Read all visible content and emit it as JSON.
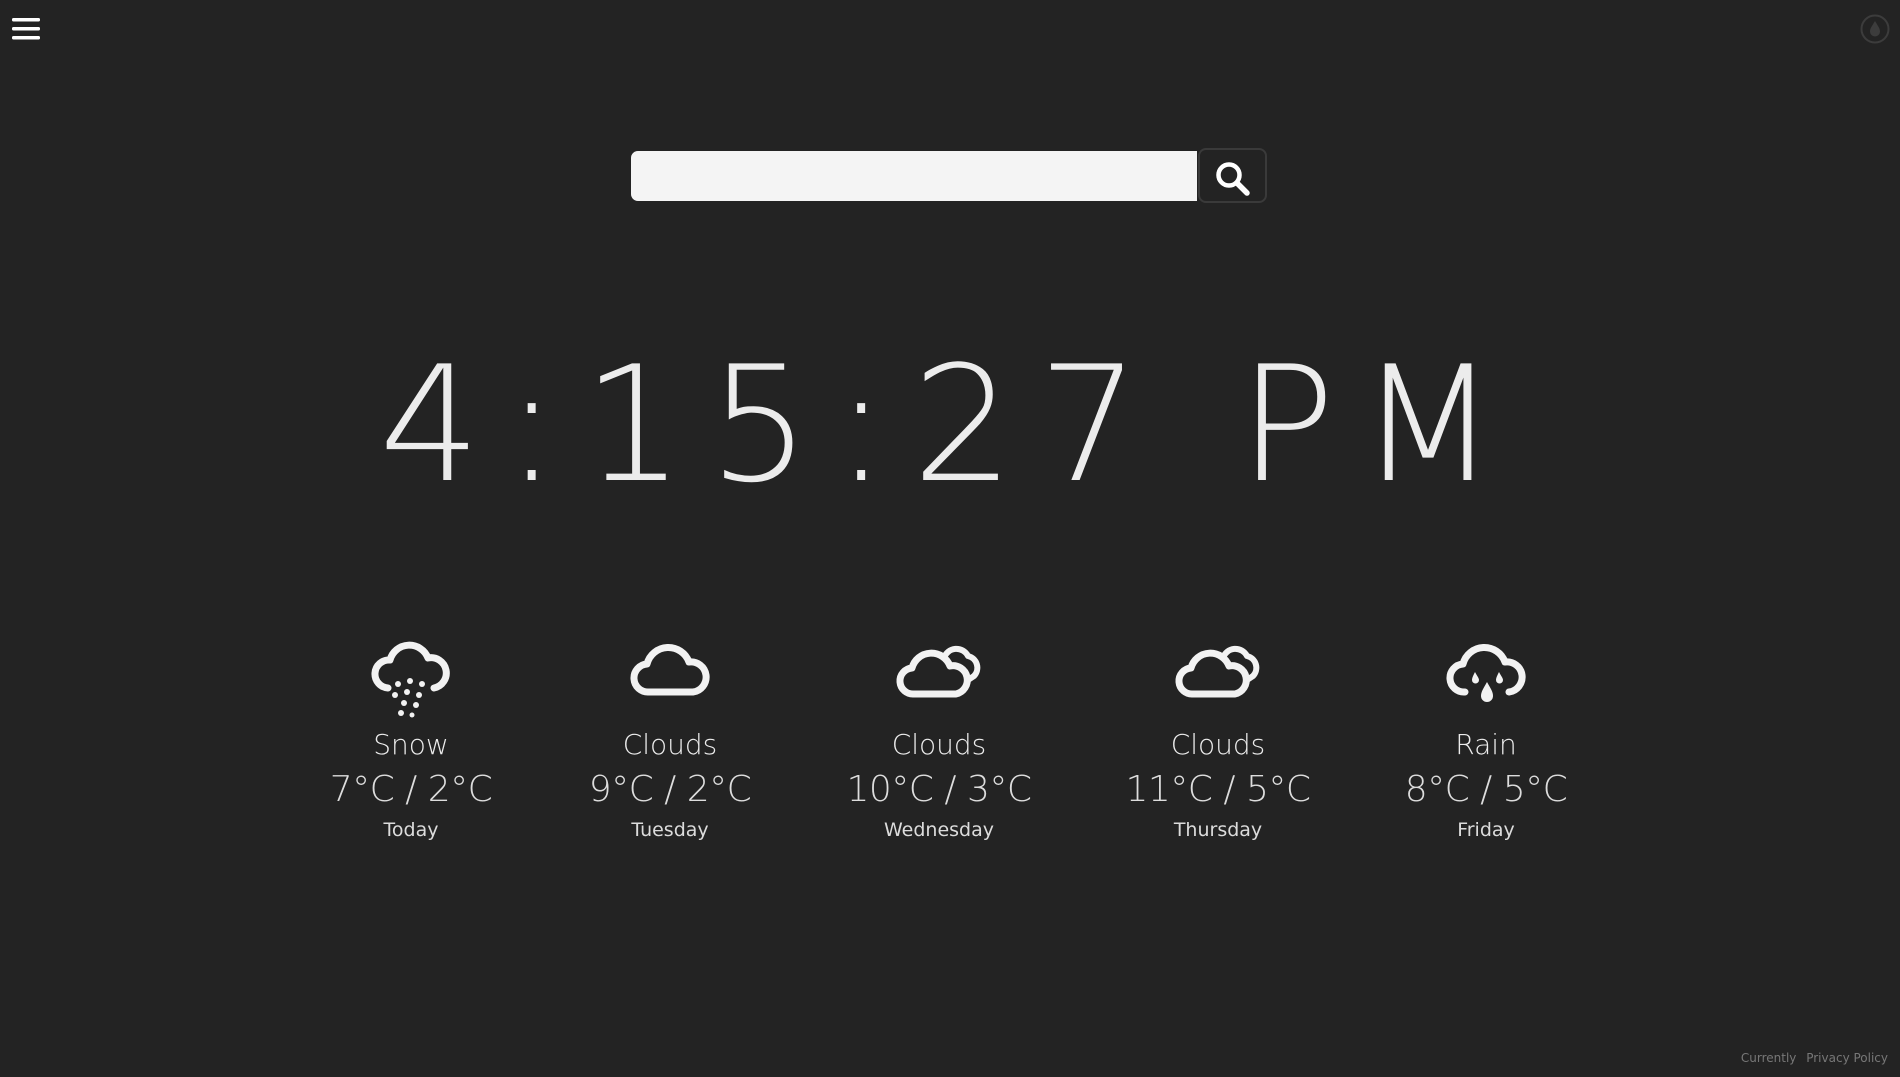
{
  "header": {
    "menu_icon": "hamburger-menu-icon",
    "theme_icon": "droplet-icon"
  },
  "search": {
    "value": "",
    "placeholder": "",
    "button_icon": "search-icon"
  },
  "clock": {
    "time": "4:15:27 PM"
  },
  "forecast": [
    {
      "icon": "snow-icon",
      "condition": "Snow",
      "temps": "7°C / 2°C",
      "day": "Today"
    },
    {
      "icon": "cloud-icon",
      "condition": "Clouds",
      "temps": "9°C / 2°C",
      "day": "Tuesday"
    },
    {
      "icon": "broken-clouds-icon",
      "condition": "Clouds",
      "temps": "10°C / 3°C",
      "day": "Wednesday"
    },
    {
      "icon": "broken-clouds-icon",
      "condition": "Clouds",
      "temps": "11°C / 5°C",
      "day": "Thursday"
    },
    {
      "icon": "rain-icon",
      "condition": "Rain",
      "temps": "8°C / 5°C",
      "day": "Friday"
    }
  ],
  "footer": {
    "brand": "Currently",
    "privacy": "Privacy Policy"
  },
  "colors": {
    "background": "#232323",
    "foreground": "#ececec",
    "search_field": "#f4f4f4"
  }
}
